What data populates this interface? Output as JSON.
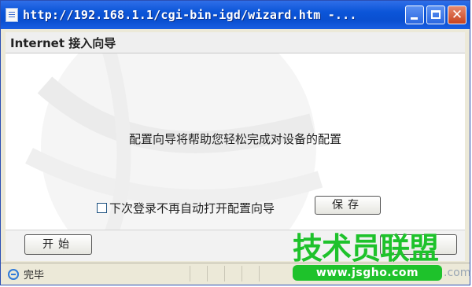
{
  "window": {
    "title": "http://192.168.1.1/cgi-bin-igd/wizard.htm -...",
    "buttons": {
      "minimize": "minimize-icon",
      "maximize": "maximize-icon",
      "close": "close-icon",
      "close_glyph": "✕"
    }
  },
  "header": {
    "title": "Internet 接入向导"
  },
  "main": {
    "message": "配置向导将帮助您轻松完成对设备的配置",
    "checkbox_label": "下次登录不再自动打开配置向导",
    "checkbox_checked": false,
    "save_label": "保存"
  },
  "footer": {
    "start_label": "开始"
  },
  "statusbar": {
    "text": "完毕"
  },
  "watermark": {
    "title": "技术员联盟",
    "url": "www.jsgho.com",
    "suffix": ".com"
  },
  "colors": {
    "titlebar": "#0b55d8",
    "watermark_green": "#1ec22b",
    "close_button": "#c8431f"
  }
}
